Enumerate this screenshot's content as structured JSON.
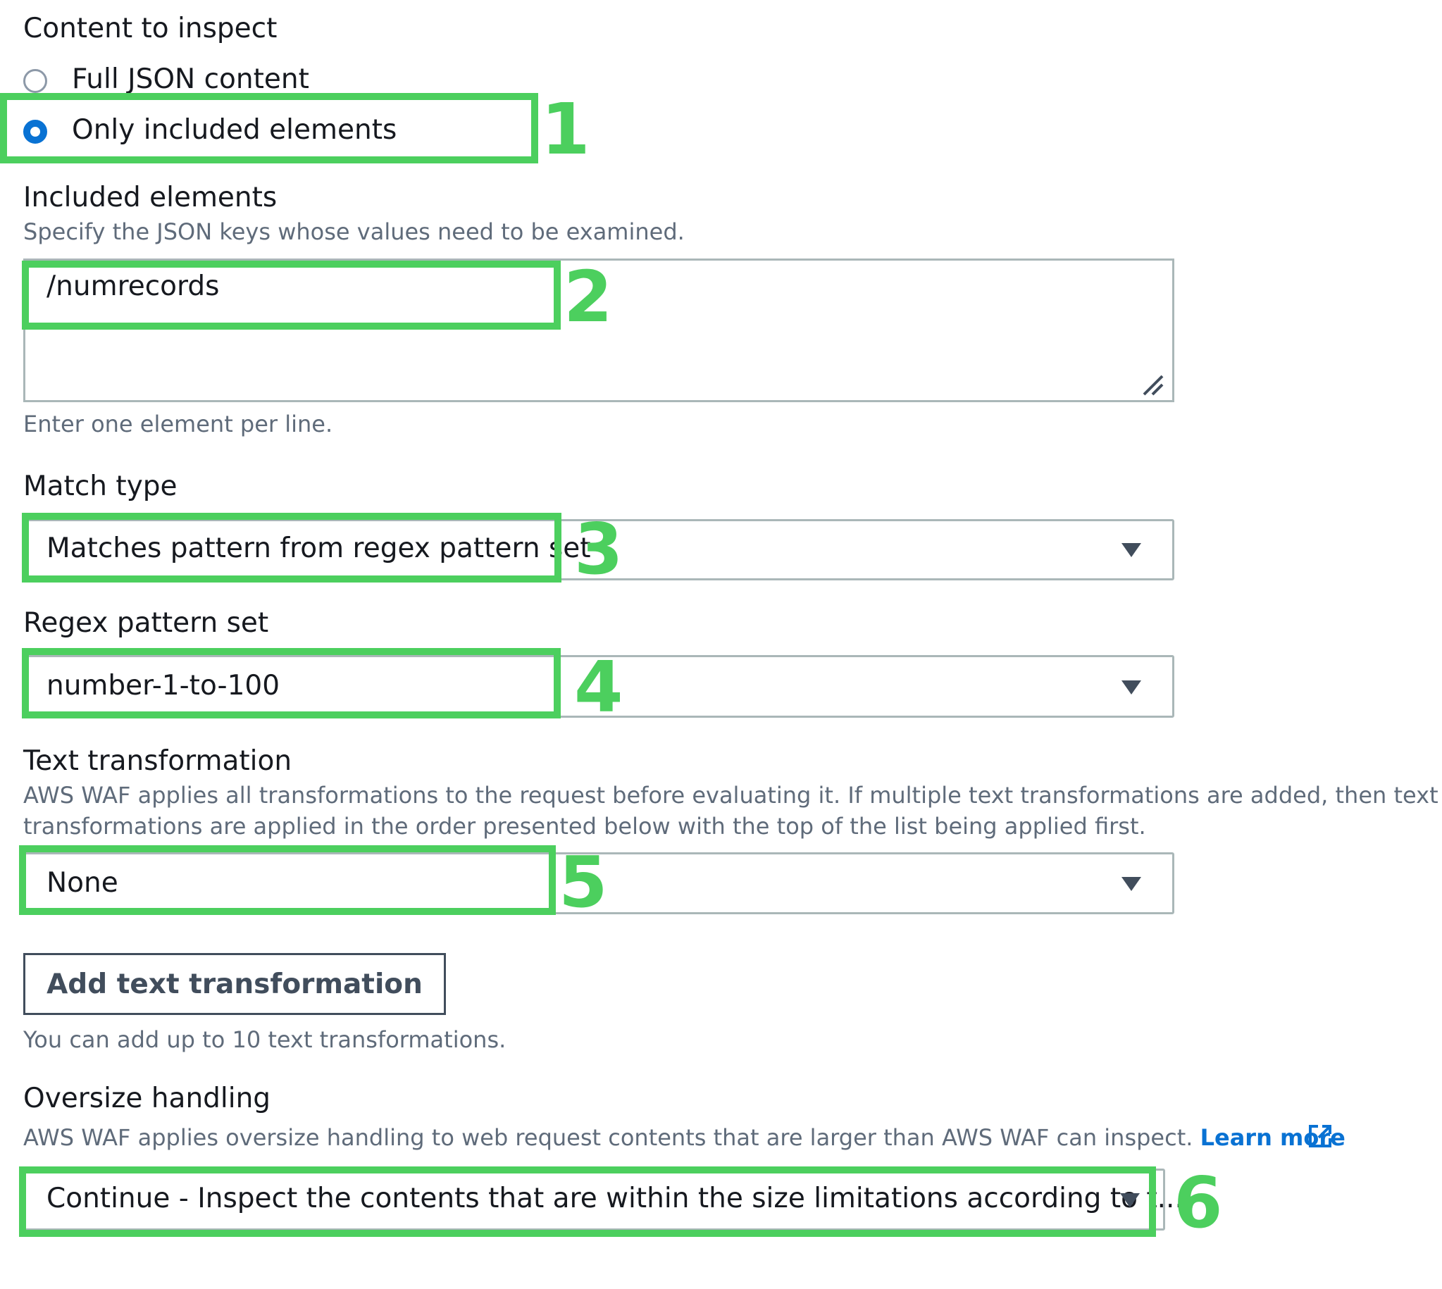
{
  "content_to_inspect": {
    "label": "Content to inspect",
    "options": [
      {
        "label": "Full JSON content",
        "selected": false
      },
      {
        "label": "Only included elements",
        "selected": true
      }
    ]
  },
  "included_elements": {
    "label": "Included elements",
    "description": "Specify the JSON keys whose values need to be examined.",
    "value": "/numrecords",
    "hint": "Enter one element per line."
  },
  "match_type": {
    "label": "Match type",
    "value": "Matches pattern from regex pattern set"
  },
  "regex_pattern_set": {
    "label": "Regex pattern set",
    "value": "number-1-to-100"
  },
  "text_transformation": {
    "label": "Text transformation",
    "description_line1": "AWS WAF applies all transformations to the request before evaluating it. If multiple text transformations are added, then text",
    "description_line2": "transformations are applied in the order presented below with the top of the list being applied first.",
    "value": "None",
    "add_button": "Add text transformation",
    "hint": "You can add up to 10 text transformations."
  },
  "oversize_handling": {
    "label": "Oversize handling",
    "description": "AWS WAF applies oversize handling to web request contents that are larger than AWS WAF can inspect.",
    "learn_more": "Learn more",
    "value": "Continue - Inspect the contents that are within the size limitations according to t..."
  },
  "annotations": [
    "1",
    "2",
    "3",
    "4",
    "5",
    "6"
  ],
  "colors": {
    "highlight": "#4ccf5e",
    "accent": "#0972d3",
    "text": "#16191f",
    "muted": "#5f6b7a",
    "border": "#aab7b8"
  },
  "icons": {
    "resize": "resize-handle-icon",
    "caret": "caret-down-icon",
    "external": "external-link-icon"
  }
}
